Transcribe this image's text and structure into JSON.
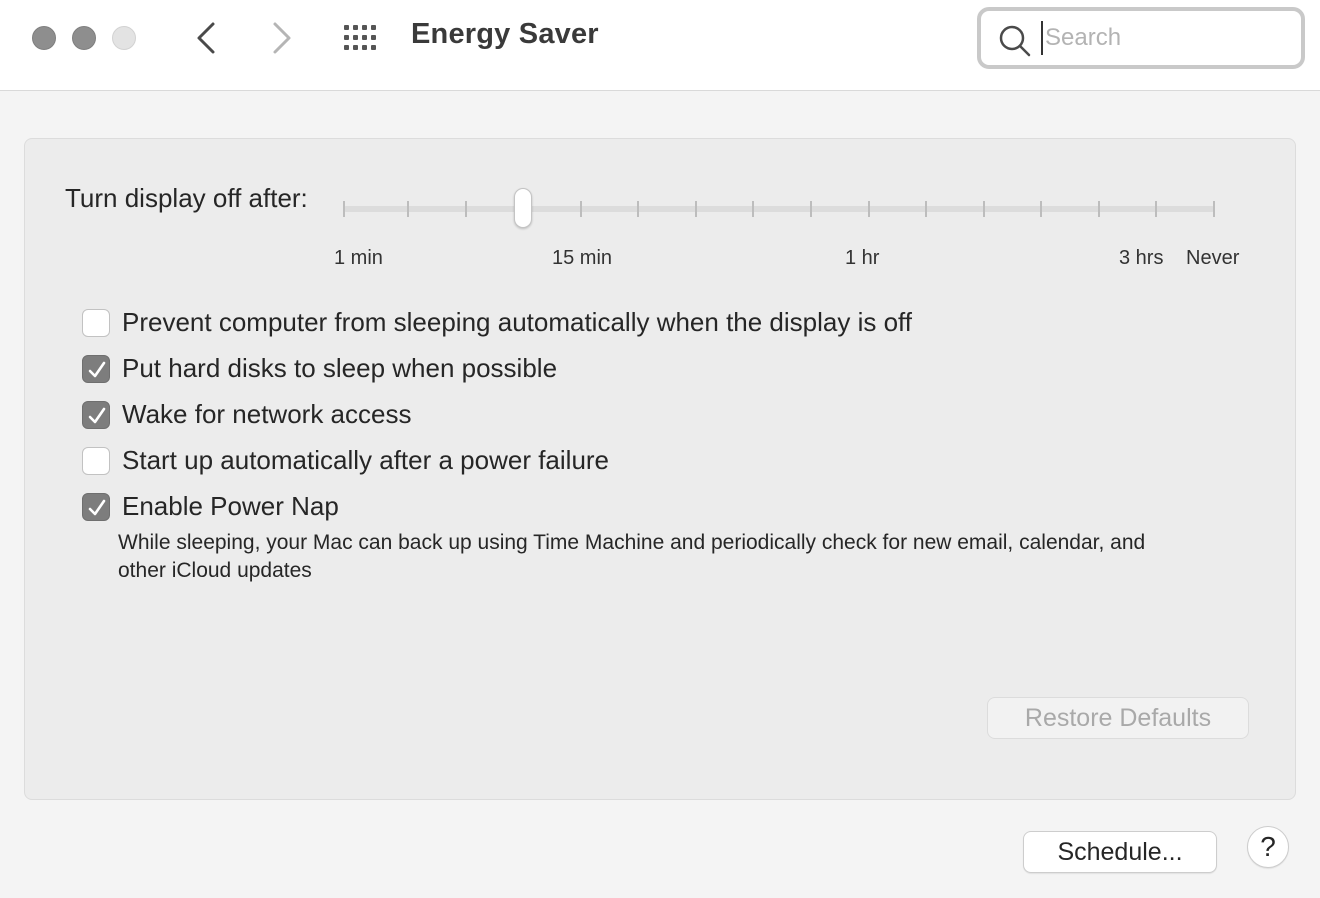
{
  "window": {
    "title": "Energy Saver",
    "traffic_lights": [
      "close",
      "minimize",
      "zoom"
    ],
    "nav_icons": [
      "chevron-left-icon",
      "chevron-right-icon",
      "grid-icon"
    ]
  },
  "search": {
    "placeholder": "Search",
    "value": "",
    "icon": "search-icon"
  },
  "display_slider": {
    "label": "Turn display off after:",
    "tick_labels": [
      "1 min",
      "15 min",
      "1 hr",
      "3 hrs",
      "Never"
    ],
    "tick_count": 16,
    "selected_tick_index": 3
  },
  "options": [
    {
      "label": "Prevent computer from sleeping automatically when the display is off",
      "checked": false
    },
    {
      "label": "Put hard disks to sleep when possible",
      "checked": true
    },
    {
      "label": "Wake for network access",
      "checked": true
    },
    {
      "label": "Start up automatically after a power failure",
      "checked": false
    },
    {
      "label": "Enable Power Nap",
      "checked": true
    }
  ],
  "power_nap_description": "While sleeping, your Mac can back up using Time Machine and periodically check for new email, calendar, and other iCloud updates",
  "buttons": {
    "restore_defaults": "Restore Defaults",
    "schedule": "Schedule...",
    "help": "?"
  },
  "colors": {
    "checkbox_checked": "#7d7d7d",
    "panel_background": "#ececec",
    "window_background": "#f4f4f4"
  }
}
